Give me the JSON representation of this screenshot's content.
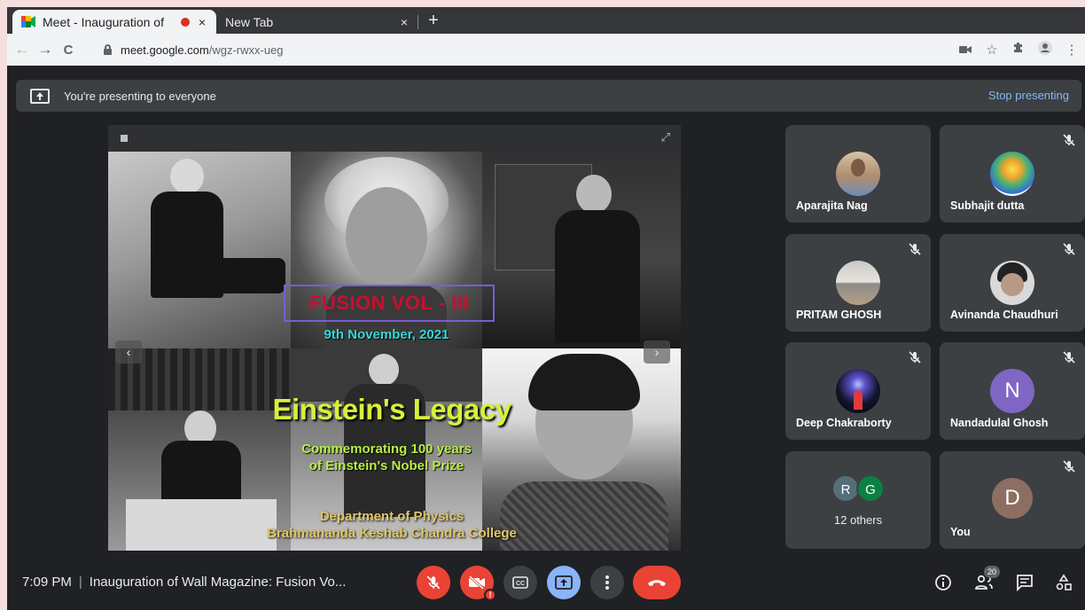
{
  "browser": {
    "tabs": [
      {
        "title": "Meet - Inauguration of",
        "active": true
      },
      {
        "title": "New Tab",
        "active": false
      }
    ],
    "close_glyph": "×",
    "new_tab_glyph": "+",
    "url_host": "meet.google.com",
    "url_path": "/wgz-rwxx-ueg",
    "nav": {
      "back": "←",
      "forward": "→",
      "reload": "C"
    }
  },
  "banner": {
    "text": "You're presenting to everyone",
    "stop_label": "Stop presenting"
  },
  "slide": {
    "title": "FUSION VOL - III",
    "date": "9th November, 2021",
    "headline": "Einstein's Legacy",
    "subtitle_line1": "Commemorating 100 years",
    "subtitle_line2": "of Einstein's Nobel Prize",
    "dept_line1": "Department of Physics",
    "dept_line2": "Brahmananda Keshab Chandra College"
  },
  "participants": [
    {
      "name": "Aparajita Nag",
      "muted": false
    },
    {
      "name": "Subhajit dutta",
      "muted": true
    },
    {
      "name": "PRITAM GHOSH",
      "muted": true
    },
    {
      "name": "Avinanda Chaudhuri",
      "muted": true
    },
    {
      "name": "Deep Chakraborty",
      "muted": true
    },
    {
      "name": "Nandadulal Ghosh",
      "muted": true,
      "initial": "N"
    },
    {
      "others": "12 others",
      "initials": [
        "R",
        "G"
      ]
    },
    {
      "name": "You",
      "muted": true,
      "initial": "D"
    }
  ],
  "bottom": {
    "time": "7:09 PM",
    "separator": "|",
    "meeting_title": "Inauguration of Wall Magazine: Fusion Vo...",
    "participant_count": "20",
    "alert_glyph": "!"
  },
  "colors": {
    "danger": "#ea4335",
    "accent": "#8ab4f8",
    "surface": "#3c4043",
    "background": "#202124",
    "avatar_n": "#7f66c4",
    "avatar_d": "#8d6e63",
    "avatar_r": "#546e7a",
    "avatar_g": "#0b8043"
  }
}
